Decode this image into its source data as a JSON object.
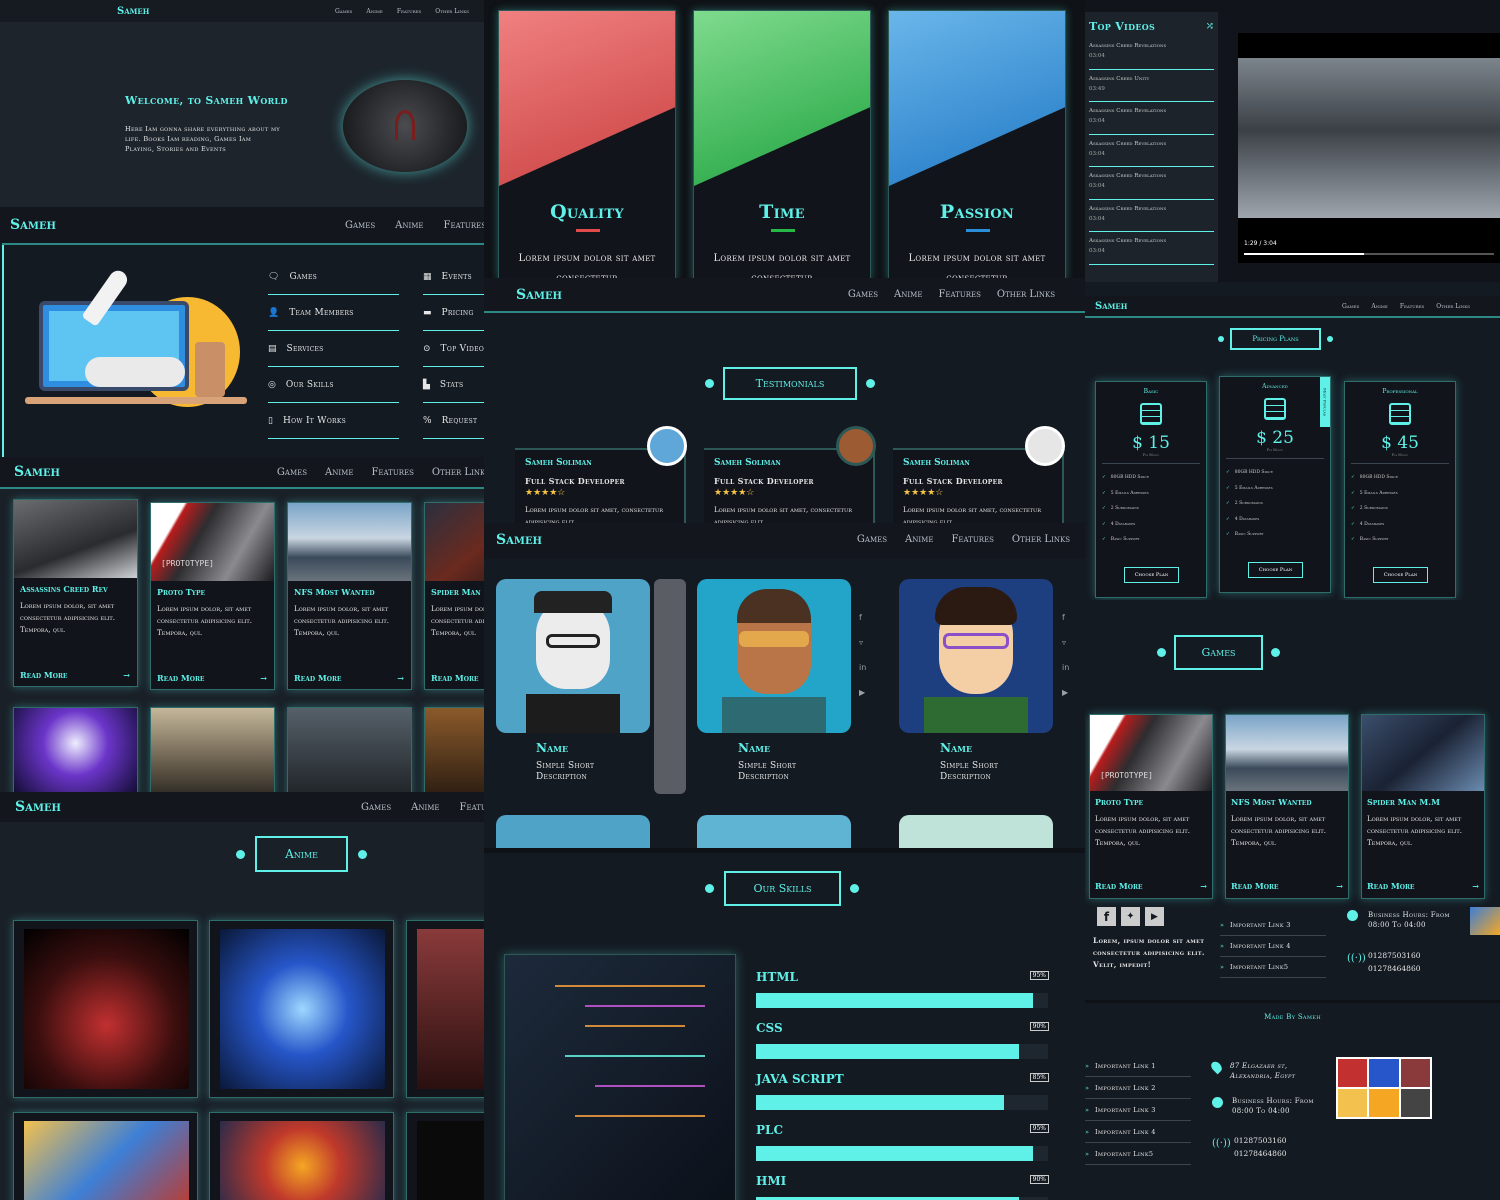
{
  "brand": "Sameh",
  "nav": [
    "Games",
    "Anime",
    "Features",
    "Other Links"
  ],
  "hero": {
    "title": "Welcome, to Sameh World",
    "text": "Here Iam gonna share everything about my life. Books Iam reading, Games Iam Playing, Stories and Events"
  },
  "links_menu": {
    "col1": [
      "Games",
      "Team Members",
      "Services",
      "Our Skills",
      "How It Works"
    ],
    "col2": [
      "Events",
      "Pricing",
      "Top Videos",
      "Stats",
      "Request"
    ]
  },
  "games_row1": [
    {
      "title": "Assassins Creed Rev",
      "text": "Lorem ipsum dolor, sit amet consectetur adipisicing elit. Tempora, qui.",
      "more": "Read More"
    },
    {
      "title": "Proto Type",
      "text": "Lorem ipsum dolor, sit amet consectetur adipisicing elit. Tempora, qui.",
      "more": "Read More",
      "label": "[PROTOTYPE]"
    },
    {
      "title": "NFS Most Wanted",
      "text": "Lorem ipsum dolor, sit amet consectetur adipisicing elit. Tempora, qui.",
      "more": "Read More"
    },
    {
      "title": "Spider Man",
      "text": "Lorem ipsum dolor, sit amet consectetur adipisicing elit. Tempora, qui.",
      "more": "Read More"
    }
  ],
  "anime_title": "Anime",
  "features": [
    {
      "title": "Quality",
      "text": "Lorem ipsum dolor sit amet consectetur",
      "color": "#e24b4b"
    },
    {
      "title": "Time",
      "text": "Lorem ipsum dolor sit amet consectetur",
      "color": "#27b84a"
    },
    {
      "title": "Passion",
      "text": "Lorem ipsum dolor sit amet consectetur",
      "color": "#2a8fd8"
    }
  ],
  "testimonials": {
    "title": "Testimonials",
    "items": [
      {
        "name": "Sameh Soliman",
        "role": "Full Stack Developer",
        "text": "Lorem ipsum dolor sit amet, consectetur adipisicing elit."
      },
      {
        "name": "Sameh Soliman",
        "role": "Full Stack Developer",
        "text": "Lorem ipsum dolor sit amet, consectetur adipisicing elit."
      },
      {
        "name": "Sameh Soliman",
        "role": "Full Stack Developer",
        "text": "Lorem ipsum dolor sit amet, consectetur adipisicing elit."
      }
    ]
  },
  "team": [
    {
      "name": "Name",
      "desc": "Simple Short Description"
    },
    {
      "name": "Name",
      "desc": "Simple Short Description"
    },
    {
      "name": "Name",
      "desc": "Simple Short Description"
    }
  ],
  "skills": {
    "title": "Our Skills",
    "items": [
      {
        "name": "HTML",
        "pct": "95%",
        "value": 95
      },
      {
        "name": "CSS",
        "pct": "90%",
        "value": 90
      },
      {
        "name": "JAVA SCRIPT",
        "pct": "85%",
        "value": 85
      },
      {
        "name": "PLC",
        "pct": "95%",
        "value": 95
      },
      {
        "name": "HMI",
        "pct": "90%",
        "value": 90
      }
    ]
  },
  "top_videos": {
    "title": "Top Videos",
    "items": [
      {
        "name": "Assassins Creed Revelations",
        "time": "03:04"
      },
      {
        "name": "Assassins Creed Unity",
        "time": "03:49"
      },
      {
        "name": "Assassins Creed Revelations",
        "time": "03:04"
      },
      {
        "name": "Assassins Creed Revelations",
        "time": "03:04"
      },
      {
        "name": "Assassins Creed Revelations",
        "time": "03:04"
      },
      {
        "name": "Assassins Creed Revelations",
        "time": "03:04"
      },
      {
        "name": "Assassins Creed Revelations",
        "time": "03:04"
      }
    ],
    "player_time": "1:29 / 3:04"
  },
  "pricing": {
    "title": "Pricing Plans",
    "plans": [
      {
        "name": "Basic",
        "price": "$ 15",
        "per": "Per Month",
        "features": [
          "80GB HDD Space",
          "5 Emails Adresses",
          "2 Subdomains",
          "4 Databases",
          "Basic Support"
        ],
        "btn": "Choose Plan"
      },
      {
        "name": "Advanced",
        "price": "$ 25",
        "per": "Per Month",
        "features": [
          "80GB HDD Space",
          "5 Emails Adresses",
          "2 Subdomains",
          "4 Databases",
          "Basic Support"
        ],
        "btn": "Choose Plan",
        "ribbon": "Most Popular"
      },
      {
        "name": "Professional",
        "price": "$ 45",
        "per": "Per Month",
        "features": [
          "80GB HDD Space",
          "5 Emails Adresses",
          "2 Subdomains",
          "4 Databases",
          "Basic Support"
        ],
        "btn": "Choose Plan"
      }
    ]
  },
  "games2": {
    "title": "Games",
    "items": [
      {
        "title": "Proto Type",
        "text": "Lorem ipsum dolor, sit amet consectetur adipisicing elit. Tempora, qui.",
        "more": "Read More",
        "label": "[PROTOTYPE]"
      },
      {
        "title": "NFS Most Wanted",
        "text": "Lorem ipsum dolor, sit amet consectetur adipisicing elit. Tempora, qui.",
        "more": "Read More"
      },
      {
        "title": "Spider Man M.M",
        "text": "Lorem ipsum dolor, sit amet consectetur adipisicing elit. Tempora, qui.",
        "more": "Read More"
      }
    ]
  },
  "footer1": {
    "text": "Lorem, ipsum dolor sit amet consectetur adipisicing elit. Velit, impedit!",
    "links": [
      "Important Link 3",
      "Important Link 4",
      "Important Link5"
    ],
    "hours": "Business Hours: From 08:00 To 04:00",
    "phone1": "01287503160",
    "phone2": "01278464860"
  },
  "footer2": {
    "made": "Made By Sameh",
    "links": [
      "Important Link 1",
      "Important Link 2",
      "Important Link 3",
      "Important Link 4",
      "Important Link5"
    ],
    "address": "87 Elgazaer st, Alexandria, Egypt",
    "hours": "Business Hours: From 08:00 To 04:00",
    "phone1": "01287503160",
    "phone2": "01278464860"
  }
}
